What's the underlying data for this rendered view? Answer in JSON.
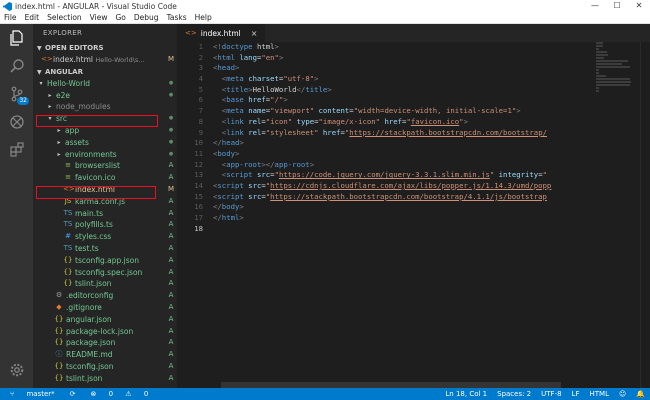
{
  "window": {
    "title": "index.html - ANGULAR - Visual Studio Code",
    "controls": [
      "—",
      "☐",
      "✕"
    ]
  },
  "menu": [
    "File",
    "Edit",
    "Selection",
    "View",
    "Go",
    "Debug",
    "Tasks",
    "Help"
  ],
  "activity": {
    "scm_badge": "32"
  },
  "sidebar": {
    "title": "EXPLORER",
    "open_editors_label": "OPEN EDITORS",
    "open_editor": {
      "name": "index.html",
      "path": "Hello-World\\s...",
      "status": "M"
    },
    "workspace_label": "ANGULAR",
    "tree": [
      {
        "name": "Hello-World",
        "depth": 0,
        "type": "folder-open",
        "status": "dot"
      },
      {
        "name": "e2e",
        "depth": 1,
        "type": "folder",
        "status": "dot"
      },
      {
        "name": "node_modules",
        "depth": 1,
        "type": "folder",
        "status": ""
      },
      {
        "name": "src",
        "depth": 1,
        "type": "folder-open",
        "status": "dot"
      },
      {
        "name": "app",
        "depth": 2,
        "type": "folder",
        "status": "dot"
      },
      {
        "name": "assets",
        "depth": 2,
        "type": "folder",
        "status": "dot"
      },
      {
        "name": "environments",
        "depth": 2,
        "type": "folder",
        "status": "dot"
      },
      {
        "name": "browserslist",
        "depth": 2,
        "type": "file",
        "status": "A"
      },
      {
        "name": "favicon.ico",
        "depth": 2,
        "type": "file",
        "status": "A"
      },
      {
        "name": "index.html",
        "depth": 2,
        "type": "html",
        "status": "M"
      },
      {
        "name": "karma.conf.js",
        "depth": 2,
        "type": "js",
        "status": "A"
      },
      {
        "name": "main.ts",
        "depth": 2,
        "type": "ts",
        "status": "A"
      },
      {
        "name": "polyfills.ts",
        "depth": 2,
        "type": "ts",
        "status": "A"
      },
      {
        "name": "styles.css",
        "depth": 2,
        "type": "css",
        "status": "A"
      },
      {
        "name": "test.ts",
        "depth": 2,
        "type": "ts",
        "status": "A"
      },
      {
        "name": "tsconfig.app.json",
        "depth": 2,
        "type": "json",
        "status": "A"
      },
      {
        "name": "tsconfig.spec.json",
        "depth": 2,
        "type": "json",
        "status": "A"
      },
      {
        "name": "tslint.json",
        "depth": 2,
        "type": "json",
        "status": "A"
      },
      {
        "name": ".editorconfig",
        "depth": 1,
        "type": "gear",
        "status": "A"
      },
      {
        "name": ".gitignore",
        "depth": 1,
        "type": "git",
        "status": "A"
      },
      {
        "name": "angular.json",
        "depth": 1,
        "type": "json",
        "status": "A"
      },
      {
        "name": "package-lock.json",
        "depth": 1,
        "type": "json",
        "status": "A"
      },
      {
        "name": "package.json",
        "depth": 1,
        "type": "json",
        "status": "A"
      },
      {
        "name": "README.md",
        "depth": 1,
        "type": "md",
        "status": "A"
      },
      {
        "name": "tsconfig.json",
        "depth": 1,
        "type": "json",
        "status": "A"
      },
      {
        "name": "tslint.json",
        "depth": 1,
        "type": "json",
        "status": "A"
      }
    ]
  },
  "editor": {
    "tab": {
      "name": "index.html",
      "close": "×"
    },
    "current_line": 18,
    "lines": [
      [
        [
          "brk",
          "<!"
        ],
        [
          "tag",
          "doctype"
        ],
        [
          "txt",
          " html"
        ],
        [
          "brk",
          ">"
        ]
      ],
      [
        [
          "brk",
          "<"
        ],
        [
          "tag",
          "html"
        ],
        [
          "txt",
          " "
        ],
        [
          "attr",
          "lang"
        ],
        [
          "txt",
          "="
        ],
        [
          "str",
          "\"en\""
        ],
        [
          "brk",
          ">"
        ]
      ],
      [
        [
          "brk",
          "<"
        ],
        [
          "tag",
          "head"
        ],
        [
          "brk",
          ">"
        ]
      ],
      [
        [
          "txt",
          "  "
        ],
        [
          "brk",
          "<"
        ],
        [
          "tag",
          "meta"
        ],
        [
          "txt",
          " "
        ],
        [
          "attr",
          "charset"
        ],
        [
          "txt",
          "="
        ],
        [
          "str",
          "\"utf-8\""
        ],
        [
          "brk",
          ">"
        ]
      ],
      [
        [
          "txt",
          "  "
        ],
        [
          "brk",
          "<"
        ],
        [
          "tag",
          "title"
        ],
        [
          "brk",
          ">"
        ],
        [
          "txt",
          "HelloWorld"
        ],
        [
          "brk",
          "</"
        ],
        [
          "tag",
          "title"
        ],
        [
          "brk",
          ">"
        ]
      ],
      [
        [
          "txt",
          "  "
        ],
        [
          "brk",
          "<"
        ],
        [
          "tag",
          "base"
        ],
        [
          "txt",
          " "
        ],
        [
          "attr",
          "href"
        ],
        [
          "txt",
          "="
        ],
        [
          "str",
          "\"/\""
        ],
        [
          "brk",
          ">"
        ]
      ],
      [
        [
          "txt",
          "  "
        ],
        [
          "brk",
          "<"
        ],
        [
          "tag",
          "meta"
        ],
        [
          "txt",
          " "
        ],
        [
          "attr",
          "name"
        ],
        [
          "txt",
          "="
        ],
        [
          "str",
          "\"viewport\""
        ],
        [
          "txt",
          " "
        ],
        [
          "attr",
          "content"
        ],
        [
          "txt",
          "="
        ],
        [
          "str",
          "\"width=device-width, initial-scale=1\""
        ],
        [
          "brk",
          ">"
        ]
      ],
      [
        [
          "txt",
          "  "
        ],
        [
          "brk",
          "<"
        ],
        [
          "tag",
          "link"
        ],
        [
          "txt",
          " "
        ],
        [
          "attr",
          "rel"
        ],
        [
          "txt",
          "="
        ],
        [
          "str",
          "\"icon\""
        ],
        [
          "txt",
          " "
        ],
        [
          "attr",
          "type"
        ],
        [
          "txt",
          "="
        ],
        [
          "str",
          "\"image/x-icon\""
        ],
        [
          "txt",
          " "
        ],
        [
          "attr",
          "href"
        ],
        [
          "txt",
          "="
        ],
        [
          "str",
          "\""
        ],
        [
          "url",
          "favicon.ico"
        ],
        [
          "str",
          "\""
        ],
        [
          "brk",
          ">"
        ]
      ],
      [
        [
          "txt",
          "  "
        ],
        [
          "brk",
          "<"
        ],
        [
          "tag",
          "link"
        ],
        [
          "txt",
          " "
        ],
        [
          "attr",
          "rel"
        ],
        [
          "txt",
          "="
        ],
        [
          "str",
          "\"stylesheet\""
        ],
        [
          "txt",
          " "
        ],
        [
          "attr",
          "href"
        ],
        [
          "txt",
          "="
        ],
        [
          "str",
          "\""
        ],
        [
          "url",
          "https://stackpath.bootstrapcdn.com/bootstrap/"
        ]
      ],
      [
        [
          "brk",
          "</"
        ],
        [
          "tag",
          "head"
        ],
        [
          "brk",
          ">"
        ]
      ],
      [
        [
          "brk",
          "<"
        ],
        [
          "tag",
          "body"
        ],
        [
          "brk",
          ">"
        ]
      ],
      [
        [
          "txt",
          "  "
        ],
        [
          "brk",
          "<"
        ],
        [
          "tag",
          "app-root"
        ],
        [
          "brk",
          "></"
        ],
        [
          "tag",
          "app-root"
        ],
        [
          "brk",
          ">"
        ]
      ],
      [
        [
          "txt",
          "  "
        ],
        [
          "brk",
          "<"
        ],
        [
          "tag",
          "script"
        ],
        [
          "txt",
          " "
        ],
        [
          "attr",
          "src"
        ],
        [
          "txt",
          "="
        ],
        [
          "str",
          "\""
        ],
        [
          "url",
          "https://code.jquery.com/jquery-3.3.1.slim.min.js"
        ],
        [
          "str",
          "\""
        ],
        [
          "txt",
          " "
        ],
        [
          "attr",
          "integrity"
        ],
        [
          "txt",
          "="
        ],
        [
          "str",
          "\""
        ]
      ],
      [
        [
          "brk",
          "<"
        ],
        [
          "tag",
          "script"
        ],
        [
          "txt",
          " "
        ],
        [
          "attr",
          "src"
        ],
        [
          "txt",
          "="
        ],
        [
          "str",
          "\""
        ],
        [
          "url",
          "https://cdnjs.cloudflare.com/ajax/libs/popper.js/1.14.3/umd/popp"
        ]
      ],
      [
        [
          "brk",
          "<"
        ],
        [
          "tag",
          "script"
        ],
        [
          "txt",
          " "
        ],
        [
          "attr",
          "src"
        ],
        [
          "txt",
          "="
        ],
        [
          "str",
          "\""
        ],
        [
          "url",
          "https://stackpath.bootstrapcdn.com/bootstrap/4.1.1/js/bootstrap"
        ]
      ],
      [
        [
          "brk",
          "</"
        ],
        [
          "tag",
          "body"
        ],
        [
          "brk",
          ">"
        ]
      ],
      [
        [
          "brk",
          "</"
        ],
        [
          "tag",
          "html"
        ],
        [
          "brk",
          ">"
        ]
      ],
      []
    ]
  },
  "status": {
    "branch": "master*",
    "sync": "⟳",
    "errors": "0",
    "warnings": "0",
    "position": "Ln 18, Col 1",
    "spaces": "Spaces: 2",
    "encoding": "UTF-8",
    "eol": "LF",
    "language": "HTML",
    "feedback": "☺",
    "bell": "🔔"
  }
}
